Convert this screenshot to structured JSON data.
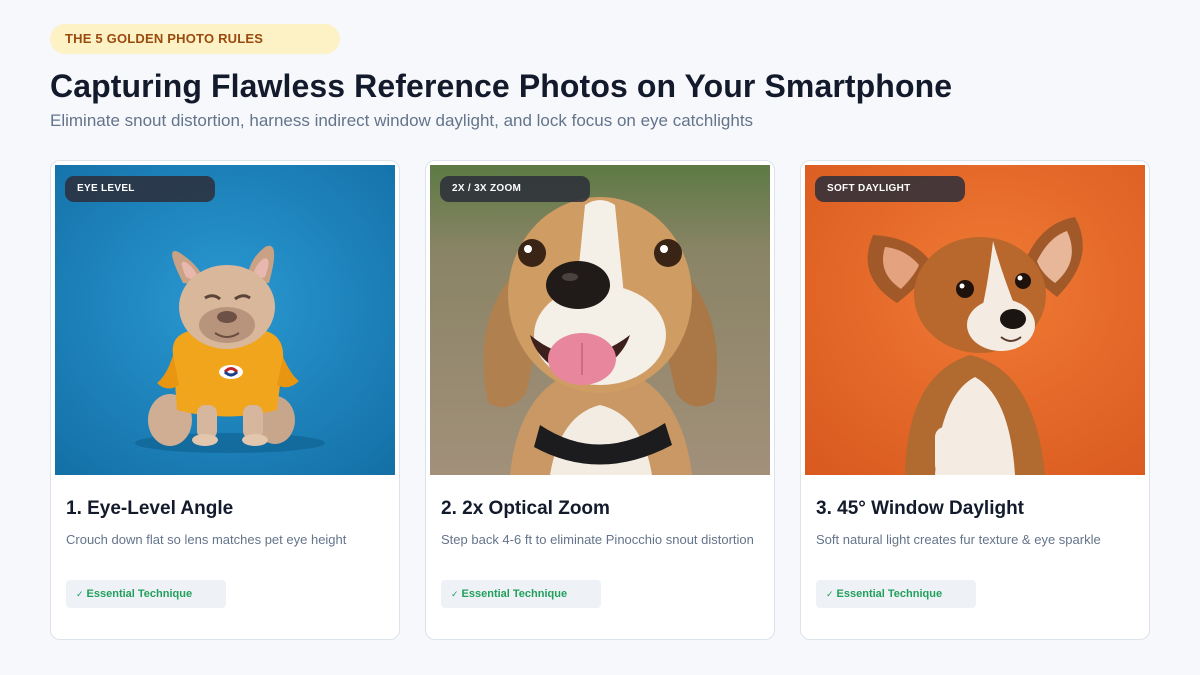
{
  "header": {
    "pill_label": "THE 5 GOLDEN PHOTO RULES",
    "title": "Capturing Flawless Reference Photos on Your Smartphone",
    "subtitle": "Eliminate snout distortion, harness indirect window daylight, and lock focus on eye catchlights"
  },
  "cards": [
    {
      "tag": "EYE LEVEL",
      "title": "1. Eye-Level Angle",
      "description": "Crouch down flat so lens matches pet eye height",
      "badge": "Essential Technique",
      "badge_icon": "check-icon",
      "photo": "french-bulldog-in-yellow-shirt-on-blue-backdrop",
      "photo_bg": "#1f86bf"
    },
    {
      "tag": "2X / 3X ZOOM",
      "title": "2. 2x Optical Zoom",
      "description": "Step back 4-6 ft to eliminate Pinocchio snout distortion",
      "badge": "Essential Technique",
      "badge_icon": "check-icon",
      "photo": "smiling-beagle-close-up-outdoors",
      "photo_bg": "#8f8a76"
    },
    {
      "tag": "SOFT DAYLIGHT",
      "title": "3. 45° Window Daylight",
      "description": "Soft natural light creates fur texture & eye sparkle",
      "badge": "Essential Technique",
      "badge_icon": "check-icon",
      "photo": "corgi-puppy-on-orange-backdrop",
      "photo_bg": "#e86a2a"
    }
  ],
  "colors": {
    "accent_pill_bg": "#fdf1c6",
    "accent_pill_text": "#9a4a0d",
    "badge_text": "#22a05b",
    "title": "#131a2b",
    "muted": "#64748b"
  }
}
